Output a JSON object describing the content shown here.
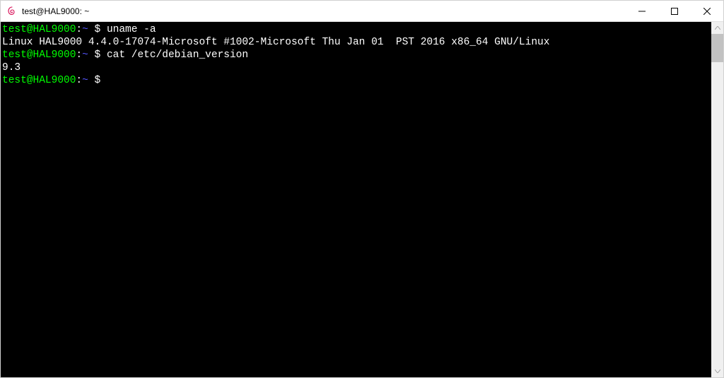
{
  "window": {
    "title": "test@HAL9000: ~",
    "icon": "debian-swirl"
  },
  "terminal": {
    "lines": [
      {
        "type": "prompt",
        "user": "test@HAL9000",
        "sep": ":",
        "path": "~",
        "dollar": " $ ",
        "command": "uname -a"
      },
      {
        "type": "output",
        "text": "Linux HAL9000 4.4.0-17074-Microsoft #1002-Microsoft Thu Jan 01  PST 2016 x86_64 GNU/Linux"
      },
      {
        "type": "prompt",
        "user": "test@HAL9000",
        "sep": ":",
        "path": "~",
        "dollar": " $ ",
        "command": "cat /etc/debian_version"
      },
      {
        "type": "output",
        "text": "9.3"
      },
      {
        "type": "prompt",
        "user": "test@HAL9000",
        "sep": ":",
        "path": "~",
        "dollar": " $ ",
        "command": ""
      }
    ]
  },
  "colors": {
    "promptUser": "#00ff00",
    "promptPath": "#5555ff",
    "background": "#000000",
    "foreground": "#ffffff"
  }
}
